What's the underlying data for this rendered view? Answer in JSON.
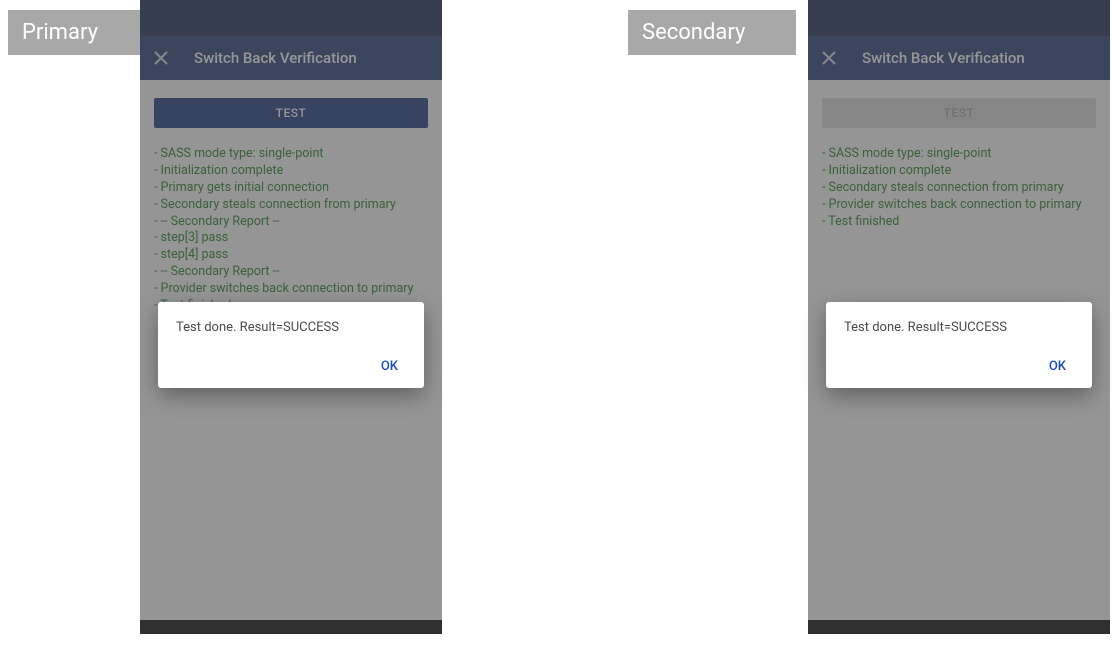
{
  "labels": {
    "primary": "Primary",
    "secondary": "Secondary"
  },
  "primary": {
    "title": "Switch Back Verification",
    "testButton": "TEST",
    "testButtonEnabled": true,
    "log": [
      "- SASS mode type: single-point",
      "- Initialization complete",
      "- Primary gets initial connection",
      "- Secondary steals connection from primary",
      "- -- Secondary Report --",
      "- step[3] pass",
      "- step[4] pass",
      "- -- Secondary Report --",
      "- Provider switches back connection to primary",
      "- Test finished"
    ],
    "dialog": {
      "message": "Test done. Result=SUCCESS",
      "ok": "OK"
    }
  },
  "secondary": {
    "title": "Switch Back Verification",
    "testButton": "TEST",
    "testButtonEnabled": false,
    "log": [
      "- SASS mode type: single-point",
      "- Initialization complete",
      "- Secondary steals connection from primary",
      "- Provider switches back connection to primary",
      "- Test finished"
    ],
    "dialog": {
      "message": "Test done. Result=SUCCESS",
      "ok": "OK"
    }
  }
}
